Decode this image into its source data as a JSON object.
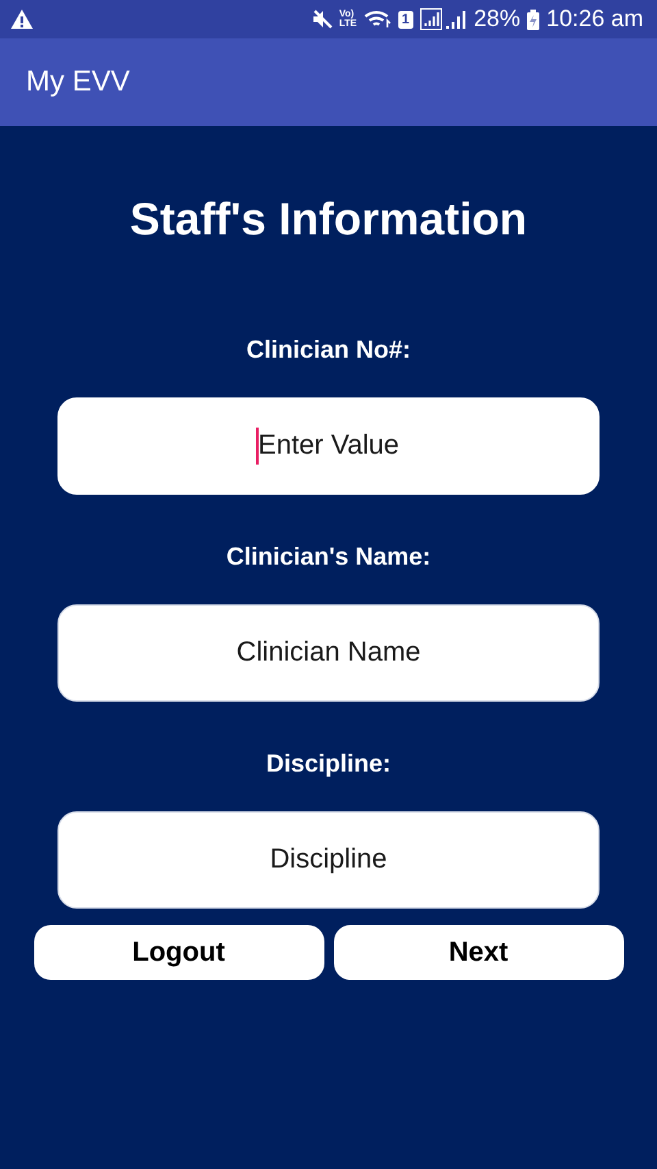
{
  "status_bar": {
    "volte_top": "Vo)",
    "volte_bottom": "LTE",
    "sim": "1",
    "battery": "28%",
    "time": "10:26 am"
  },
  "app_bar": {
    "title": "My EVV"
  },
  "heading": "Staff's Information",
  "fields": [
    {
      "label": "Clinician No#:",
      "placeholder": "Enter Value",
      "focused": true
    },
    {
      "label": "Clinician's Name:",
      "placeholder": "Clinician Name",
      "focused": false
    },
    {
      "label": "Discipline:",
      "placeholder": "Discipline",
      "focused": false
    }
  ],
  "buttons": [
    "Logout",
    "Next"
  ]
}
